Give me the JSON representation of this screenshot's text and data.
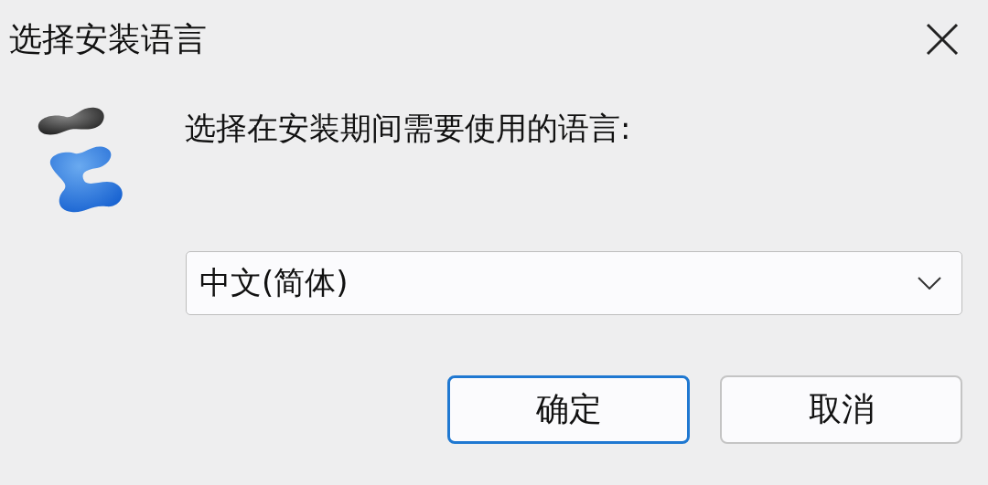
{
  "window": {
    "title": "选择安装语言"
  },
  "prompt": "选择在安装期间需要使用的语言:",
  "language_select": {
    "value": "中文(简体)"
  },
  "buttons": [
    {
      "label": "确定",
      "default": true
    },
    {
      "label": "取消",
      "default": false
    }
  ]
}
